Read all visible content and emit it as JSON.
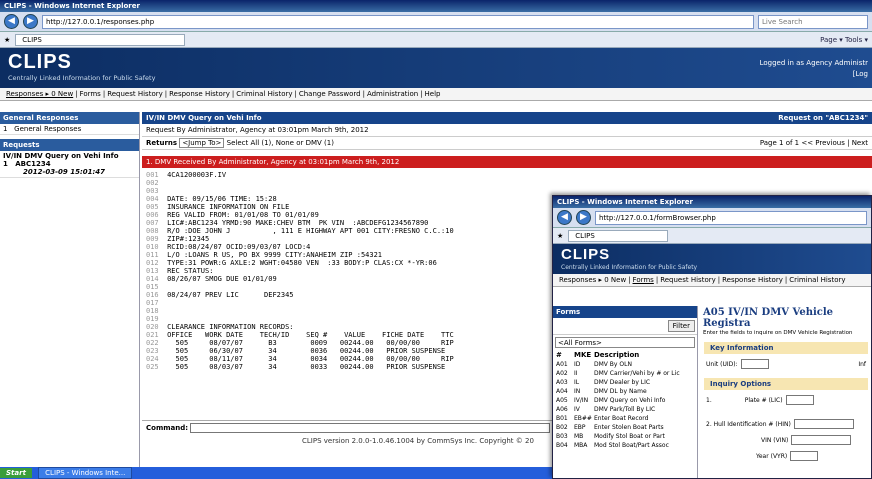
{
  "window1": {
    "title": "CLIPS - Windows Internet Explorer",
    "url": "http://127.0.0.1/responses.php",
    "search_placeholder": "Live Search",
    "tab": "CLIPS",
    "tools_label": "Page ▾  Tools ▾",
    "app": {
      "logo": "CLIPS",
      "tagline": "Centrally Linked Information for Public Safety",
      "login_line1": "Logged in as Agency Administr",
      "login_line2": "[Log"
    },
    "menu": [
      "Responses ▸ 0 New",
      "Forms",
      "Request History",
      "Response History",
      "Criminal History",
      "Change Password",
      "Administration",
      "Help"
    ],
    "sidebar": {
      "gen_head": "General Responses",
      "gen_row_num": "1",
      "gen_row_label": "General Responses",
      "req_head": "Requests",
      "req_item": "IV/IN DMV Query on Vehi Info",
      "req_num": "1",
      "req_plate": "ABC1234",
      "req_date": "2012-03-09 15:01:47"
    },
    "main": {
      "title": "IV/IN DMV Query on Vehi Info",
      "request_on": "Request on \"ABC1234\"",
      "requested_by": "Request By Administrator, Agency at 03:01pm March 9th, 2012",
      "returns": "Returns",
      "jump": "<Jump To>",
      "select": "Select All (1), None or DMV (1)",
      "page": "Page 1 of 1 << Previous | Next",
      "redbar": "1. DMV Received By Administrator, Agency at 03:01pm March 9th, 2012",
      "report": [
        [
          "001",
          "4CA1200003F.IV"
        ],
        [
          "002",
          ""
        ],
        [
          "003",
          ""
        ],
        [
          "004",
          "DATE: 09/15/06 TIME: 15:28"
        ],
        [
          "005",
          "INSURANCE INFORMATION ON FILE"
        ],
        [
          "006",
          "REG VALID FROM: 01/01/08 TO 01/01/09"
        ],
        [
          "007",
          "LIC#:ABC1234 YRMD:90 MAKE:CHEV BTM  PK VIN  :ABCDEFG1234567890"
        ],
        [
          "008",
          "R/O :DOE JOHN J          , 111 E HIGHWAY APT 001 CITY:FRESNO C.C.:10"
        ],
        [
          "009",
          "ZIP#:12345"
        ],
        [
          "010",
          "RCID:08/24/07 OCID:09/03/07 LOCD:4"
        ],
        [
          "011",
          "L/O :LOANS R US, PO BX 9999 CITY:ANAHEIM ZIP :54321"
        ],
        [
          "012",
          "TYPE:31 POWR:G AXLE:2 WGHT:04580 VEN  :33 BODY:P CLAS:CX *-YR:06"
        ],
        [
          "013",
          "REC STATUS:"
        ],
        [
          "014",
          "08/26/07 SMOG DUE 01/01/09"
        ],
        [
          "015",
          ""
        ],
        [
          "016",
          "08/24/07 PREV LIC      DEF2345"
        ],
        [
          "017",
          ""
        ],
        [
          "018",
          ""
        ],
        [
          "019",
          ""
        ],
        [
          "020",
          "CLEARANCE INFORMATION RECORDS:"
        ],
        [
          "021",
          "OFFICE   WORK DATE    TECH/ID    SEQ #    VALUE    FICHE DATE    TTC"
        ],
        [
          "022",
          "  505     08/07/07      B3        0009   00244.00   00/00/00     RIP"
        ],
        [
          "023",
          "  505     06/30/07      34        0036   00244.00   PRIOR SUSPENSE"
        ],
        [
          "024",
          "  505     08/11/07      34        0034   00244.00   00/00/00     RIP"
        ],
        [
          "025",
          "  505     08/03/07      34        0033   00244.00   PRIOR SUSPENSE"
        ]
      ],
      "command_label": "Command:",
      "version": "CLIPS version 2.0.0-1.0.46.1004 by CommSys Inc. Copyright © 20"
    },
    "taskbar": {
      "start": "Start",
      "task": "CLIPS - Windows Inte..."
    }
  },
  "window2": {
    "title": "CLIPS - Windows Internet Explorer",
    "url": "http://127.0.0.1/formBrowser.php",
    "tab": "CLIPS",
    "logo": "CLIPS",
    "tagline": "Centrally Linked Information for Public Safety",
    "menu": [
      "Responses ▸ 0 New",
      "Forms",
      "Request History",
      "Response History",
      "Criminal History"
    ],
    "forms_head": "Forms",
    "filter_btn": "Filter",
    "select": "<All Forms>",
    "cols": [
      "#",
      "MKE",
      "Description"
    ],
    "forms": [
      [
        "A01",
        "ID",
        "DMV By OLN"
      ],
      [
        "A02",
        "II",
        "DMV Carrier/Vehi by # or Lic"
      ],
      [
        "A03",
        "IL",
        "DMV Dealer by LIC"
      ],
      [
        "A04",
        "IN",
        "DMV DL by Name"
      ],
      [
        "A05",
        "IV/IN",
        "DMV Query on Vehi Info"
      ],
      [
        "A06",
        "IV",
        "DMV Park/Toll By LIC"
      ],
      [
        "B01",
        "EB##",
        "Enter Boat Record"
      ],
      [
        "B02",
        "EBP",
        "Enter Stolen Boat Parts"
      ],
      [
        "B03",
        "MB",
        "Modify Stol Boat or Part"
      ],
      [
        "B04",
        "MBA",
        "Mod Stol Boat/Part Assoc"
      ]
    ],
    "form_title": "A05 IV/IN DMV Vehicle Registra",
    "form_sub": "Enter the fields to inquire on DMV Vehicle Registration",
    "key_info": "Key Information",
    "unit_label": "Unit (UID):",
    "info_label": "Inf",
    "inquiry": "Inquiry Options",
    "opt1_num": "1.",
    "plate_label": "Plate # (LIC)",
    "opt2_label": "2.  Hull Identification # (HIN)",
    "vin_label": "VIN (VIN)",
    "year_label": "Year (VYR)"
  }
}
